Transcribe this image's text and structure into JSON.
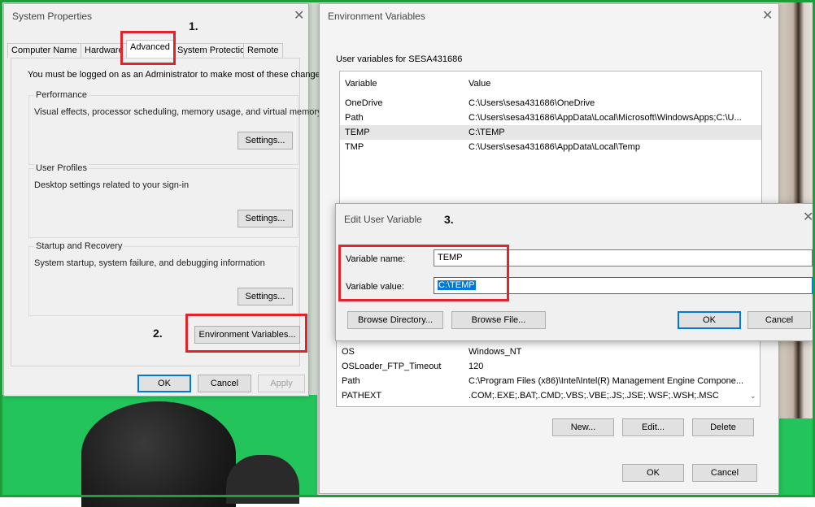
{
  "system_properties": {
    "title": "System Properties",
    "tabs": [
      "Computer Name",
      "Hardware",
      "Advanced",
      "System Protection",
      "Remote"
    ],
    "active_tab": "Advanced",
    "admin_note": "You must be logged on as an Administrator to make most of these changes.",
    "performance": {
      "title": "Performance",
      "desc": "Visual effects, processor scheduling, memory usage, and virtual memory",
      "button": "Settings..."
    },
    "user_profiles": {
      "title": "User Profiles",
      "desc": "Desktop settings related to your sign-in",
      "button": "Settings..."
    },
    "startup_recovery": {
      "title": "Startup and Recovery",
      "desc": "System startup, system failure, and debugging information",
      "button": "Settings..."
    },
    "env_button": "Environment Variables...",
    "ok": "OK",
    "cancel": "Cancel",
    "apply": "Apply"
  },
  "environment_variables": {
    "title": "Environment Variables",
    "user_vars_label": "User variables for SESA431686",
    "col_variable": "Variable",
    "col_value": "Value",
    "user_vars": [
      {
        "name": "OneDrive",
        "value": "C:\\Users\\sesa431686\\OneDrive"
      },
      {
        "name": "Path",
        "value": "C:\\Users\\sesa431686\\AppData\\Local\\Microsoft\\WindowsApps;C:\\U..."
      },
      {
        "name": "TEMP",
        "value": "C:\\TEMP"
      },
      {
        "name": "TMP",
        "value": "C:\\Users\\sesa431686\\AppData\\Local\\Temp"
      }
    ],
    "system_vars": [
      {
        "name": "OS",
        "value": "Windows_NT"
      },
      {
        "name": "OSLoader_FTP_Timeout",
        "value": "120"
      },
      {
        "name": "Path",
        "value": "C:\\Program Files (x86)\\Intel\\Intel(R) Management Engine Compone..."
      },
      {
        "name": "PATHEXT",
        "value": ".COM;.EXE;.BAT;.CMD;.VBS;.VBE;.JS;.JSE;.WSF;.WSH;.MSC"
      }
    ],
    "new": "New...",
    "edit": "Edit...",
    "delete": "Delete",
    "ok": "OK",
    "cancel": "Cancel"
  },
  "edit_user_variable": {
    "title": "Edit User Variable",
    "name_label": "Variable name:",
    "name_value": "TEMP",
    "value_label": "Variable value:",
    "value_value": "C:\\TEMP",
    "browse_dir": "Browse Directory...",
    "browse_file": "Browse File...",
    "ok": "OK",
    "cancel": "Cancel"
  },
  "steps": {
    "one": "1.",
    "two": "2.",
    "three": "3."
  },
  "icons": {
    "close": "close-icon",
    "scroll_down": "chevron-down-icon",
    "scroll_up": "chevron-up-icon"
  }
}
